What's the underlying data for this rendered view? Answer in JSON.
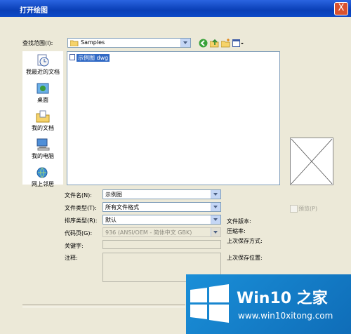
{
  "window": {
    "title": "打开绘图",
    "close_label": "X"
  },
  "lookin": {
    "label": "查找范围(I):",
    "value": "Samples"
  },
  "places": [
    {
      "label": "我最近的文档",
      "icon": "recent-documents-icon"
    },
    {
      "label": "桌面",
      "icon": "desktop-icon"
    },
    {
      "label": "我的文档",
      "icon": "my-documents-icon"
    },
    {
      "label": "我的电脑",
      "icon": "my-computer-icon"
    },
    {
      "label": "网上邻居",
      "icon": "network-places-icon"
    }
  ],
  "files": [
    {
      "name": "示例图 dwg",
      "selected": true
    }
  ],
  "form": {
    "filename": {
      "label": "文件名(N):",
      "value": "示例图"
    },
    "filetype": {
      "label": "文件类型(T):",
      "value": "所有文件格式"
    },
    "sorttype": {
      "label": "排序类型(R):",
      "value": "默认"
    },
    "codepage": {
      "label": "代码页(G):",
      "value": "936 (ANSI/OEM - 简体中文 GBK)"
    },
    "keywords": {
      "label": "关键字:"
    },
    "comments": {
      "label": "注释:"
    }
  },
  "preview": {
    "checkbox_label": "预览(P)"
  },
  "info": {
    "file_version": "文件版本:",
    "compression": "压缩率:",
    "last_saved_by": "上次保存方式:",
    "last_saved_location": "上次保存位置:"
  },
  "watermark": {
    "title": "Win10 之家",
    "site": "www.win10xitong.com"
  }
}
